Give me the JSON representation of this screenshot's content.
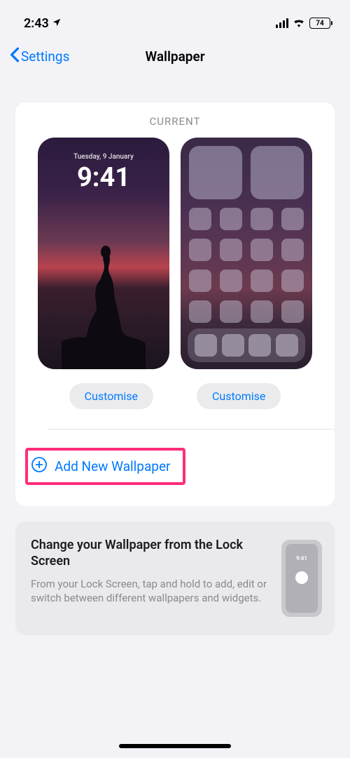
{
  "statusBar": {
    "time": "2:43",
    "battery": "74"
  },
  "nav": {
    "back": "Settings",
    "title": "Wallpaper"
  },
  "currentSection": {
    "heading": "CURRENT",
    "lockScreen": {
      "date": "Tuesday, 9 January",
      "time": "9:41"
    },
    "customiseLeft": "Customise",
    "customiseRight": "Customise"
  },
  "addNew": {
    "label": "Add New Wallpaper"
  },
  "infoCard": {
    "title": "Change your Wallpaper from the Lock Screen",
    "body": "From your Lock Screen, tap and hold to add, edit or switch between different wallpapers and widgets.",
    "miniTime": "9:41"
  }
}
